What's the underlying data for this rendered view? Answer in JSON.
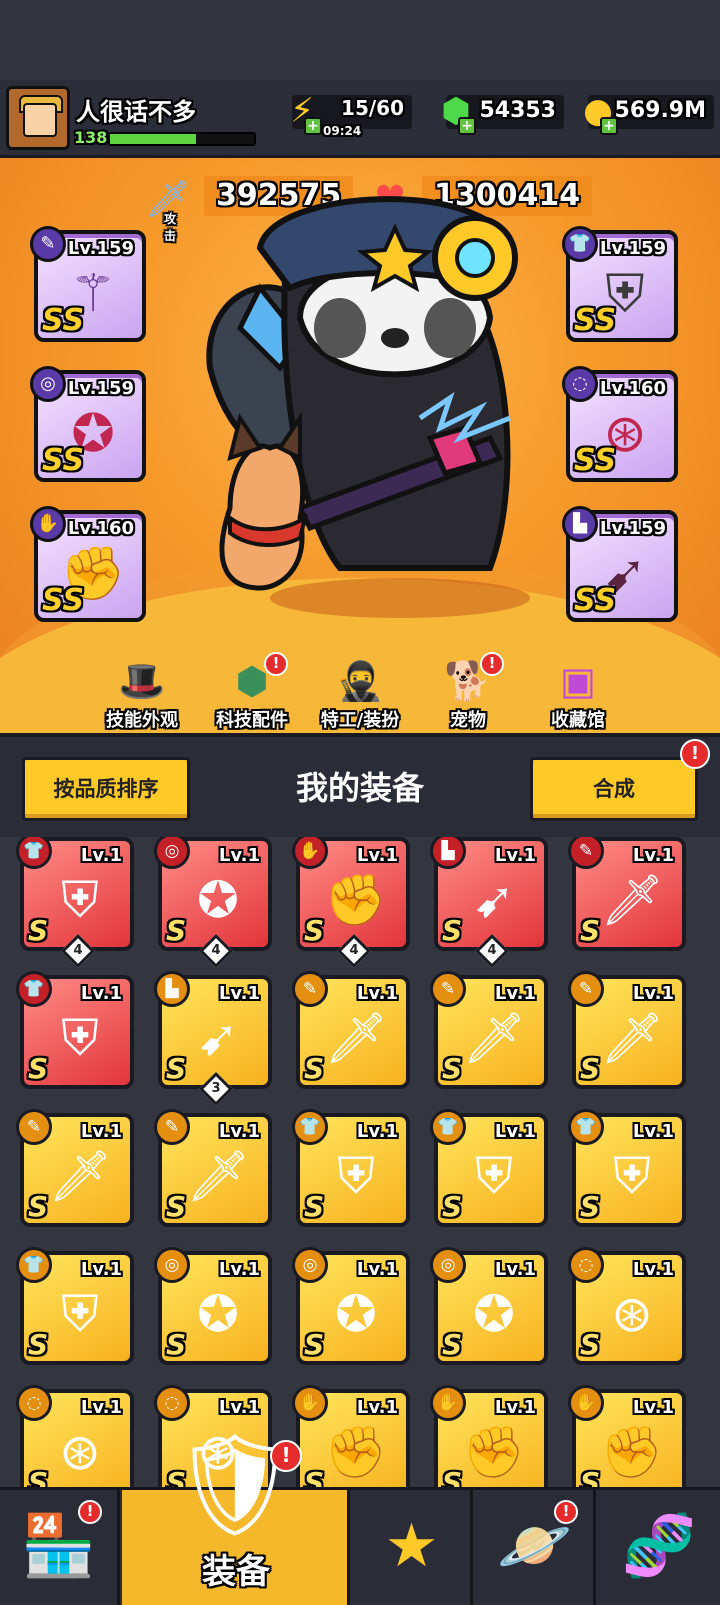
{
  "player": {
    "name": "人很话不多",
    "level": "138",
    "xp_fraction": 0.6
  },
  "resources": {
    "energy": {
      "icon": "lightning-icon",
      "value": "15/60",
      "timer": "09:24"
    },
    "gems": {
      "icon": "green-gem-icon",
      "value": "54353"
    },
    "coins": {
      "icon": "gold-coin-icon",
      "value": "569.9M"
    }
  },
  "stats": {
    "attack": {
      "label": "攻击",
      "value": "392575",
      "icon": "sword-icon"
    },
    "hp": {
      "label": "生命",
      "value": "1300414",
      "icon": "heart-icon"
    }
  },
  "equipped": [
    {
      "slot": "weapon",
      "level": "Lv.159",
      "grade": "SS",
      "icon": "staff-icon"
    },
    {
      "slot": "necklace",
      "level": "Lv.159",
      "grade": "SS",
      "icon": "necklace-icon"
    },
    {
      "slot": "gloves",
      "level": "Lv.160",
      "grade": "SS",
      "icon": "gauntlet-icon"
    },
    {
      "slot": "armor",
      "level": "Lv.159",
      "grade": "SS",
      "icon": "armor-icon"
    },
    {
      "slot": "belt",
      "level": "Lv.160",
      "grade": "SS",
      "icon": "belt-icon"
    },
    {
      "slot": "boots",
      "level": "Lv.159",
      "grade": "SS",
      "icon": "boots-icon"
    }
  ],
  "hero_menu": [
    {
      "label": "技能外观",
      "icon": "wizard-hat-icon",
      "alert": false
    },
    {
      "label": "科技配件",
      "icon": "hex-chip-icon",
      "alert": true
    },
    {
      "label": "特工/装扮",
      "icon": "agent-icon",
      "alert": false
    },
    {
      "label": "宠物",
      "icon": "dog-icon",
      "alert": true
    },
    {
      "label": "收藏馆",
      "icon": "chest-icon",
      "alert": false
    }
  ],
  "controls": {
    "sort_label": "按品质排序",
    "title": "我的装备",
    "merge_label": "合成"
  },
  "inventory": [
    {
      "rarity": "red",
      "slot": "armor",
      "level": "Lv.1",
      "grade": "S",
      "count": "4"
    },
    {
      "rarity": "red",
      "slot": "necklace",
      "level": "Lv.1",
      "grade": "S",
      "count": "4"
    },
    {
      "rarity": "red",
      "slot": "gloves",
      "level": "Lv.1",
      "grade": "S",
      "count": "4"
    },
    {
      "rarity": "red",
      "slot": "boots",
      "level": "Lv.1",
      "grade": "S",
      "count": "4"
    },
    {
      "rarity": "red",
      "slot": "weapon",
      "level": "Lv.1",
      "grade": "S",
      "count": ""
    },
    {
      "rarity": "red",
      "slot": "armor",
      "level": "Lv.1",
      "grade": "S",
      "count": ""
    },
    {
      "rarity": "yellow",
      "slot": "boots",
      "level": "Lv.1",
      "grade": "S",
      "count": "3"
    },
    {
      "rarity": "yellow",
      "slot": "weapon",
      "level": "Lv.1",
      "grade": "S",
      "count": ""
    },
    {
      "rarity": "yellow",
      "slot": "weapon",
      "level": "Lv.1",
      "grade": "S",
      "count": ""
    },
    {
      "rarity": "yellow",
      "slot": "weapon",
      "level": "Lv.1",
      "grade": "S",
      "count": ""
    },
    {
      "rarity": "yellow",
      "slot": "weapon",
      "level": "Lv.1",
      "grade": "S",
      "count": ""
    },
    {
      "rarity": "yellow",
      "slot": "weapon",
      "level": "Lv.1",
      "grade": "S",
      "count": ""
    },
    {
      "rarity": "yellow",
      "slot": "armor",
      "level": "Lv.1",
      "grade": "S",
      "count": ""
    },
    {
      "rarity": "yellow",
      "slot": "armor",
      "level": "Lv.1",
      "grade": "S",
      "count": ""
    },
    {
      "rarity": "yellow",
      "slot": "armor",
      "level": "Lv.1",
      "grade": "S",
      "count": ""
    },
    {
      "rarity": "yellow",
      "slot": "armor",
      "level": "Lv.1",
      "grade": "S",
      "count": ""
    },
    {
      "rarity": "yellow",
      "slot": "necklace",
      "level": "Lv.1",
      "grade": "S",
      "count": ""
    },
    {
      "rarity": "yellow",
      "slot": "necklace",
      "level": "Lv.1",
      "grade": "S",
      "count": ""
    },
    {
      "rarity": "yellow",
      "slot": "necklace",
      "level": "Lv.1",
      "grade": "S",
      "count": ""
    },
    {
      "rarity": "yellow",
      "slot": "belt",
      "level": "Lv.1",
      "grade": "S",
      "count": ""
    },
    {
      "rarity": "yellow",
      "slot": "belt",
      "level": "Lv.1",
      "grade": "S",
      "count": ""
    },
    {
      "rarity": "yellow",
      "slot": "belt",
      "level": "Lv.1",
      "grade": "S",
      "count": ""
    },
    {
      "rarity": "yellow",
      "slot": "gloves",
      "level": "Lv.1",
      "grade": "S",
      "count": ""
    },
    {
      "rarity": "yellow",
      "slot": "gloves",
      "level": "Lv.1",
      "grade": "S",
      "count": ""
    },
    {
      "rarity": "yellow",
      "slot": "gloves",
      "level": "Lv.1",
      "grade": "S",
      "count": ""
    }
  ],
  "nav": {
    "shop": {
      "icon": "shop-icon",
      "alert": true
    },
    "equipment": {
      "label": "装备",
      "icon": "equipment-icon",
      "alert": true
    },
    "heroes": {
      "icon": "star-swords-icon",
      "alert": false
    },
    "planet": {
      "icon": "planet-icon",
      "alert": true
    },
    "talent": {
      "icon": "dna-icon",
      "alert": false
    }
  },
  "colors": {
    "accent_orange": "#f69a2b",
    "rarity_red": "#e2353b",
    "rarity_yellow": "#f7b21f",
    "button_yellow": "#ffc928",
    "alert_red": "#e52b2b"
  }
}
